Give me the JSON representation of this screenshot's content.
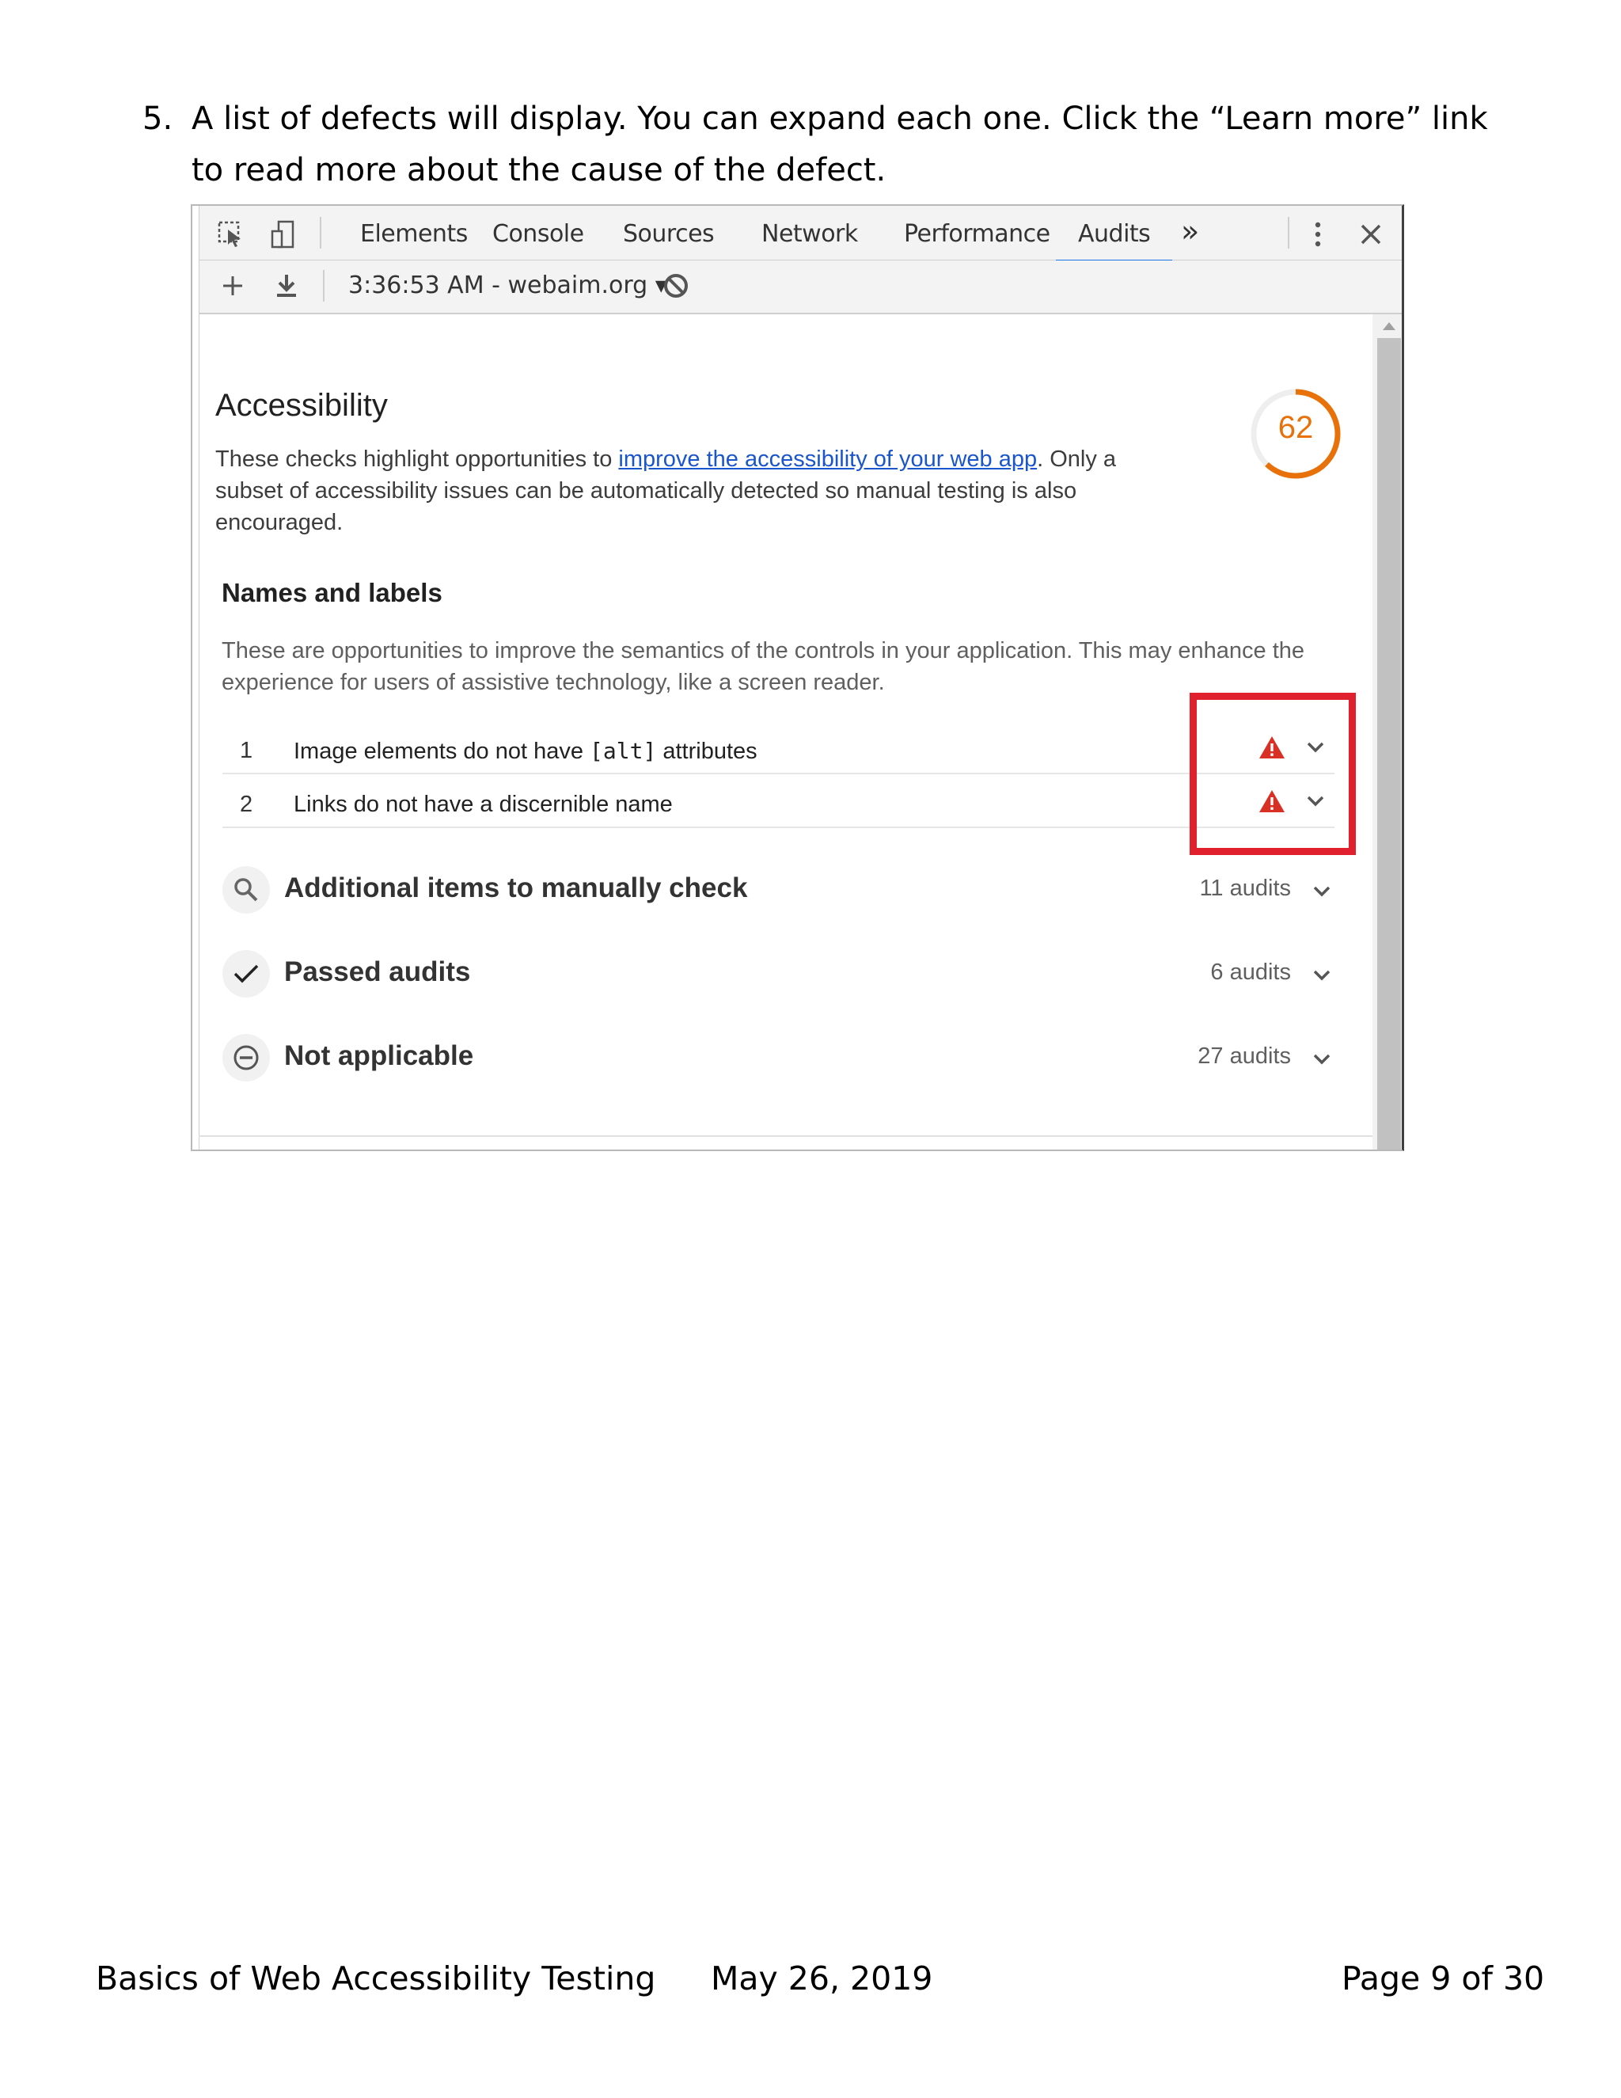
{
  "step": {
    "number": "5.",
    "text": "A list of defects will display. You can expand each one. Click the “Learn more” link to read more about the cause of the defect."
  },
  "devtools": {
    "tabs": [
      "Elements",
      "Console",
      "Sources",
      "Network",
      "Performance",
      "Audits"
    ],
    "active_tab": "Audits",
    "more_tabs_glyph": "»",
    "report_selector": "3:36:53 AM - webaim.org ▾"
  },
  "accessibility": {
    "title": "Accessibility",
    "score": "62",
    "score_fraction": 0.62,
    "score_color": "#e8710a",
    "desc_before": "These checks highlight opportunities to ",
    "desc_link": "improve the accessibility of your web app",
    "desc_after": ". Only a subset of accessibility issues can be automatically detected so manual testing is also encouraged."
  },
  "names_labels": {
    "title": "Names and labels",
    "description": "These are opportunities to improve the semantics of the controls in your application. This may enhance the experience for users of assistive technology, like a screen reader.",
    "audits": [
      {
        "index": "1",
        "label_pre": "Image elements do not have ",
        "code": "[alt]",
        "label_post": " attributes"
      },
      {
        "index": "2",
        "label_pre": "Links do not have a discernible name",
        "code": "",
        "label_post": ""
      }
    ]
  },
  "sections": [
    {
      "title": "Additional items to manually check",
      "count": "11 audits",
      "icon": "search-icon"
    },
    {
      "title": "Passed audits",
      "count": "6 audits",
      "icon": "checkmark-icon"
    },
    {
      "title": "Not applicable",
      "count": "27 audits",
      "icon": "minus-circle-icon"
    }
  ],
  "colors": {
    "warning": "#d93025",
    "highlight": "#e0202c",
    "link": "#1a55cc"
  },
  "footer": {
    "title": "Basics of Web Accessibility Testing",
    "date": "May 26, 2019",
    "page": "Page 9 of 30"
  }
}
